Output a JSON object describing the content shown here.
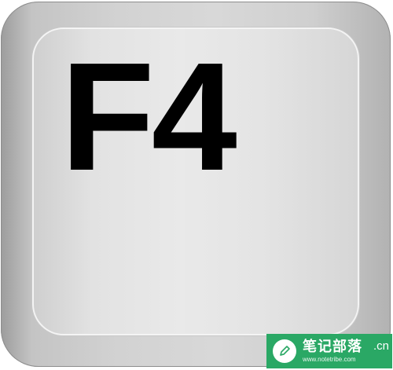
{
  "key": {
    "label": "F4"
  },
  "watermark": {
    "title": "笔记部落",
    "url": "www.notetribe.com",
    "suffix": ".cn",
    "icon": "pencil-icon",
    "color": "#2aa865"
  },
  "colors": {
    "key_outer": "#bcbcbc",
    "key_top": "#e6e6e6",
    "label": "#000000"
  }
}
